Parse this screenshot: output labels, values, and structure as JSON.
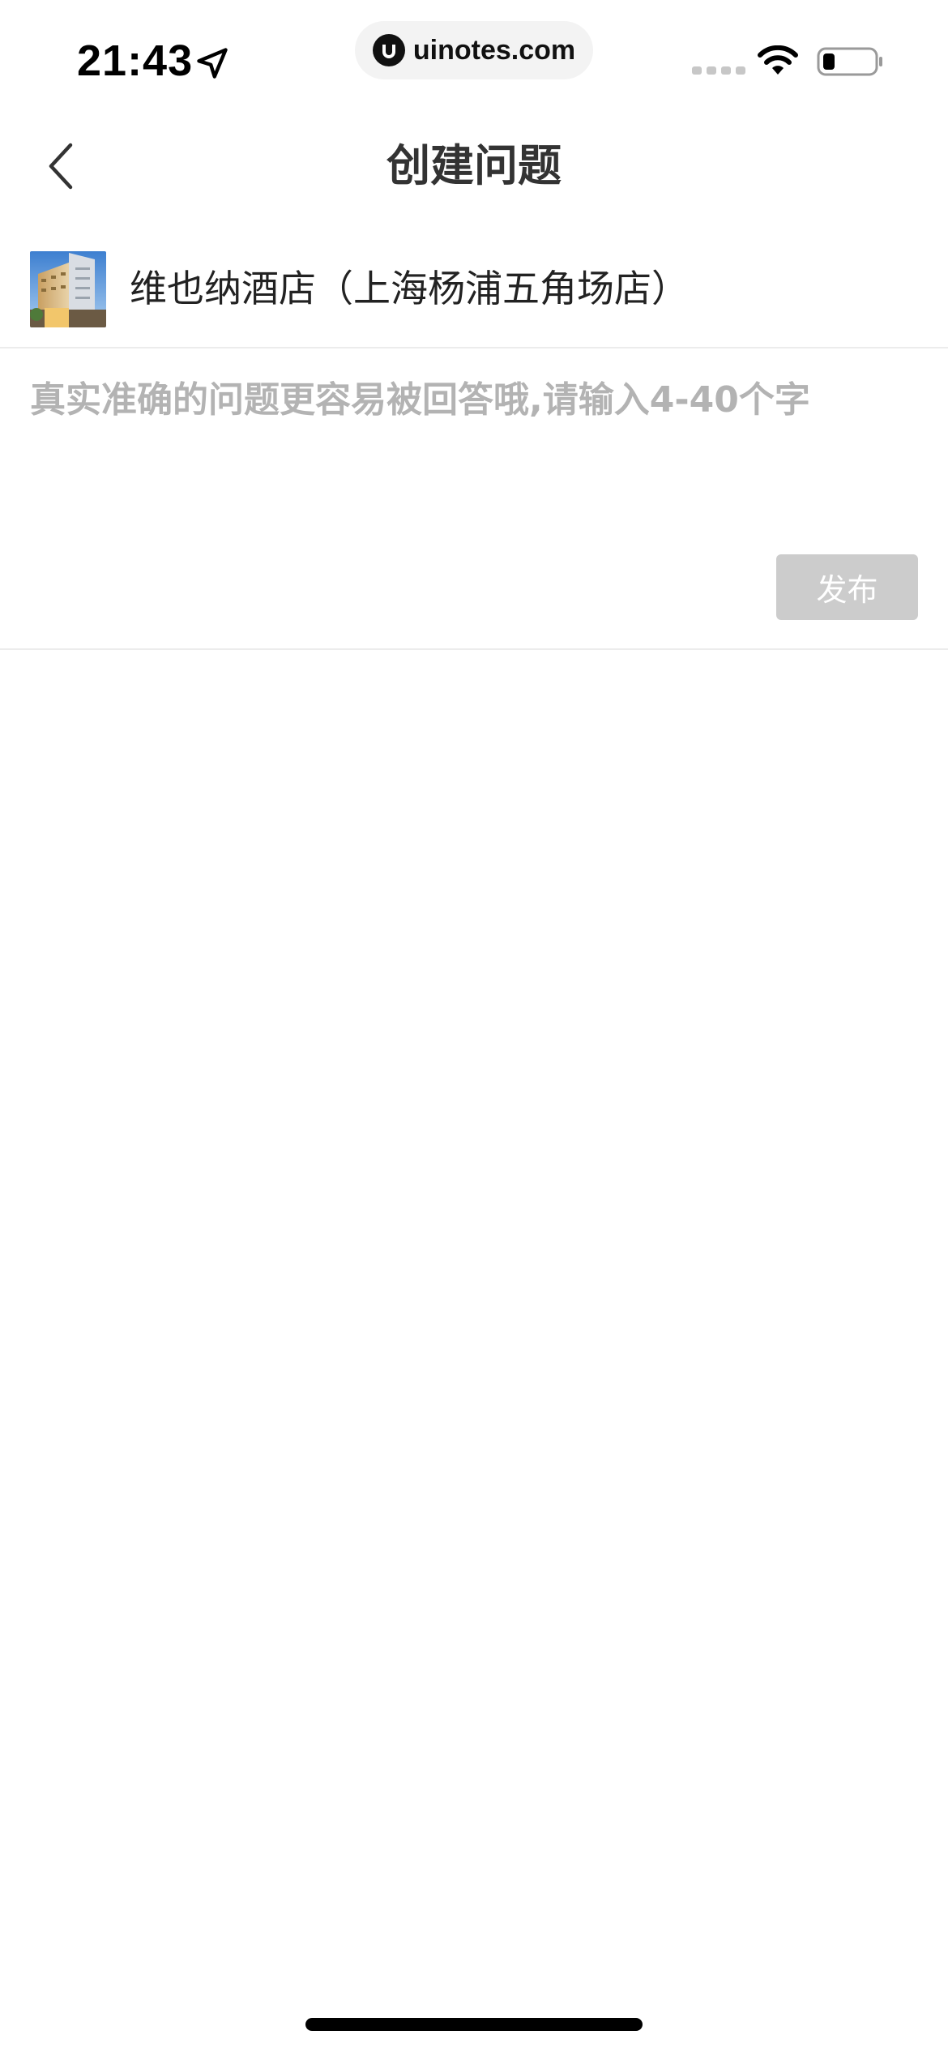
{
  "status_bar": {
    "time": "21:43",
    "url": "uinotes.com",
    "icons": [
      "location-arrow-icon",
      "signal-icon",
      "wifi-icon",
      "battery-icon"
    ]
  },
  "nav": {
    "title": "创建问题",
    "back_icon": "chevron-left-icon"
  },
  "hotel": {
    "name": "维也纳酒店（上海杨浦五角场店）",
    "thumbnail_icon": "hotel-photo"
  },
  "question": {
    "value": "",
    "placeholder": "真实准确的问题更容易被回答哦,请输入4-40个字"
  },
  "actions": {
    "publish_label": "发布",
    "publish_enabled": false
  },
  "colors": {
    "background": "#ffffff",
    "title_text": "#333333",
    "placeholder": "#b3b3b3",
    "publish_disabled_bg": "#cccccc",
    "divider": "#ececec"
  }
}
